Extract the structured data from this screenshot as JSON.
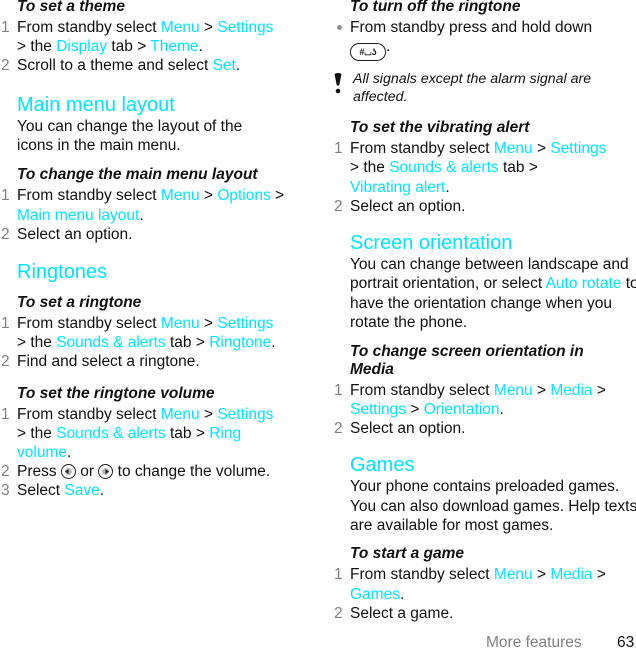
{
  "page": {
    "footer_label": "More features",
    "page_number": "63",
    "colors": {
      "link": "#00e5ff",
      "step_number": "#808080",
      "text": "#111111"
    }
  },
  "left": {
    "theme": {
      "title": "To set a theme",
      "steps": [
        {
          "num": "1",
          "parts": [
            "From standby select ",
            "Menu",
            " > ",
            "Settings",
            " > the ",
            "Display",
            " tab > ",
            "Theme",
            "."
          ]
        },
        {
          "num": "2",
          "parts": [
            "Scroll to a theme and select ",
            "Set",
            "."
          ]
        }
      ]
    },
    "main_menu": {
      "heading": "Main menu layout",
      "intro": "You can change the layout of the icons in the main menu.",
      "proc_title": "To change the main menu layout",
      "steps": [
        {
          "num": "1",
          "parts": [
            "From standby select ",
            "Menu",
            " > ",
            "Options",
            " > ",
            "Main menu layout",
            "."
          ]
        },
        {
          "num": "2",
          "text": "Select an option."
        }
      ]
    },
    "ringtones": {
      "heading": "Ringtones",
      "set_title": "To set a ringtone",
      "set_steps": [
        {
          "num": "1",
          "parts": [
            "From standby select ",
            "Menu",
            " > ",
            "Settings",
            " > the ",
            "Sounds & alerts",
            " tab > ",
            "Ringtone",
            "."
          ]
        },
        {
          "num": "2",
          "text": "Find and select a ringtone."
        }
      ],
      "volume_title": "To set the ringtone volume",
      "volume_steps": [
        {
          "num": "1",
          "parts": [
            "From standby select ",
            "Menu",
            " > ",
            "Settings",
            " > the ",
            "Sounds & alerts",
            " tab > ",
            "Ring volume",
            "."
          ]
        },
        {
          "num": "2",
          "parts": [
            "Press ",
            "left-nav-key-icon",
            " or ",
            "right-nav-key-icon",
            " to change the volume."
          ]
        },
        {
          "num": "3",
          "parts": [
            "Select ",
            "Save",
            "."
          ]
        }
      ]
    }
  },
  "right": {
    "turn_off": {
      "title": "To turn off the ringtone",
      "bullet_parts": [
        "From standby press and hold down ",
        "#-key",
        "."
      ],
      "key_label": "#⌴ʖ",
      "note": "All signals except the alarm signal are affected."
    },
    "vibrating": {
      "title": "To set the vibrating alert",
      "steps": [
        {
          "num": "1",
          "parts": [
            "From standby select ",
            "Menu",
            " > ",
            "Settings",
            " > the ",
            "Sounds & alerts",
            " tab > ",
            "Vibrating alert",
            "."
          ]
        },
        {
          "num": "2",
          "text": "Select an option."
        }
      ]
    },
    "orientation": {
      "heading": "Screen orientation",
      "intro_parts": [
        "You can change between landscape and portrait orientation, or select ",
        "Auto rotate",
        " to have the orientation change when you rotate the phone."
      ],
      "proc_title": "To change screen orientation in Media",
      "steps": [
        {
          "num": "1",
          "parts": [
            "From standby select ",
            "Menu",
            " > ",
            "Media",
            " > ",
            "Settings",
            " > ",
            "Orientation",
            "."
          ]
        },
        {
          "num": "2",
          "text": "Select an option."
        }
      ]
    },
    "games": {
      "heading": "Games",
      "intro": "Your phone contains preloaded games. You can also download games. Help texts are available for most games.",
      "proc_title": "To start a game",
      "steps": [
        {
          "num": "1",
          "parts": [
            "From standby select ",
            "Menu",
            " > ",
            "Media",
            " > ",
            "Games",
            "."
          ]
        },
        {
          "num": "2",
          "text": "Select a game."
        }
      ]
    }
  }
}
